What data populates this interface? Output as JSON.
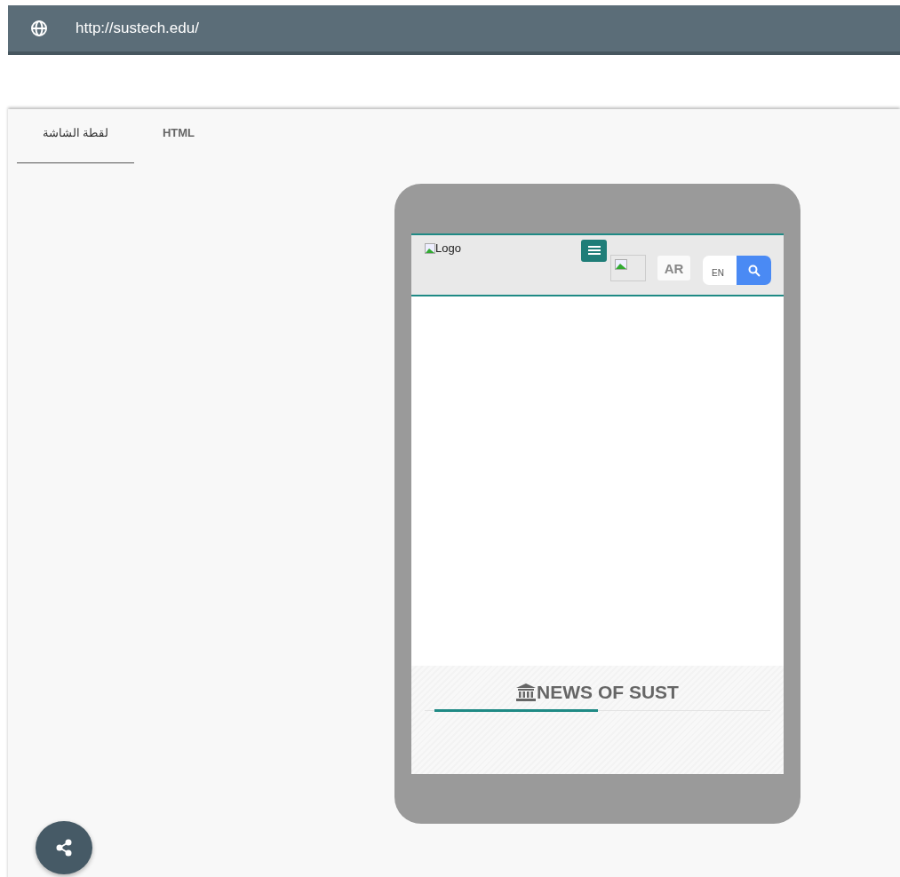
{
  "address_bar": {
    "url": "http://sustech.edu/"
  },
  "tabs": [
    {
      "label": "لقطة الشاشة",
      "selected": true
    },
    {
      "label": "HTML",
      "selected": false
    }
  ],
  "preview": {
    "header": {
      "logo_alt": "Logo",
      "language_button": "AR",
      "search_field": {
        "placeholder": "EN"
      }
    },
    "news_heading": "NEWS OF SUST"
  }
}
